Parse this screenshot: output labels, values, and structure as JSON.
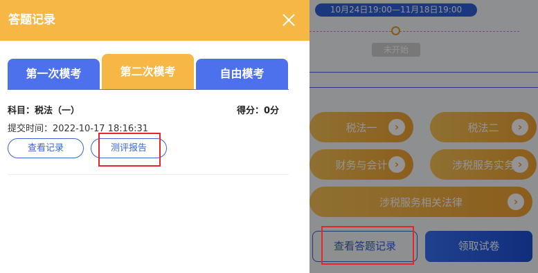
{
  "background": {
    "date_range": "10月24日19:00—11月18日19:00",
    "status": "未开始",
    "subjects": [
      "税法一",
      "税法二",
      "财务与会计",
      "涉税服务实务",
      "涉税服务相关法律"
    ],
    "view_records_label": "查看答题记录",
    "get_paper_label": "领取试卷",
    "arrow_glyph": "›"
  },
  "modal": {
    "title": "答题记录",
    "tabs": [
      "第一次模考",
      "第二次模考",
      "自由模考"
    ],
    "active_tab": "第二次模考",
    "record": {
      "subject": "科目：税法（一）",
      "score": "得分：0分",
      "submit_time": "提交时间：2022-10-17 18:16:31",
      "view_record_label": "查看记录",
      "report_label": "测评报告"
    }
  },
  "colors": {
    "header_orange": "#f6b745",
    "tab_blue": "#4d70ec",
    "highlight_red": "#e4252b",
    "primary_blue": "#2f5fd8"
  }
}
